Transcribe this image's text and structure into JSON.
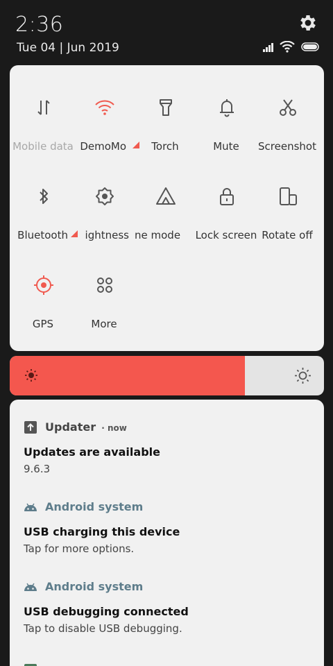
{
  "status_bar": {
    "time": "2:36",
    "date": "Tue 04 | Jun 2019",
    "icons": [
      "signal-icon",
      "wifi-icon",
      "battery-icon"
    ]
  },
  "quick_settings": {
    "tiles": [
      {
        "label": "Mobile data",
        "icon": "data-arrows-icon",
        "state": "off"
      },
      {
        "label": "DemoMo",
        "icon": "wifi-icon",
        "state": "on",
        "expandable": true
      },
      {
        "label": "Torch",
        "icon": "torch-icon",
        "state": "off"
      },
      {
        "label": "Mute",
        "icon": "bell-icon",
        "state": "off"
      },
      {
        "label": "Screenshot",
        "icon": "scissors-icon",
        "state": "off"
      },
      {
        "label": "Bluetooth",
        "icon": "bluetooth-icon",
        "state": "off",
        "expandable": true
      },
      {
        "label": "ightness",
        "icon": "auto-brightness-icon",
        "state": "off"
      },
      {
        "label": "ne mode",
        "icon": "airplane-mode-icon",
        "state": "off"
      },
      {
        "label": "Lock screen",
        "icon": "lock-icon",
        "state": "off"
      },
      {
        "label": "Rotate off",
        "icon": "rotate-icon",
        "state": "off"
      },
      {
        "label": "GPS",
        "icon": "gps-icon",
        "state": "on"
      },
      {
        "label": "More",
        "icon": "grid-icon",
        "state": "off"
      }
    ]
  },
  "brightness": {
    "level_percent": 75,
    "accent": "#f4574e"
  },
  "notifications": [
    {
      "app": "Updater",
      "time": "now",
      "title": "Updates are available",
      "body": "9.6.3",
      "icon": "upload-arrow-icon"
    },
    {
      "app": "Android system",
      "time": "",
      "title": "USB charging this device",
      "body": "Tap for more options.",
      "icon": "android-icon"
    },
    {
      "app": "Android system",
      "time": "",
      "title": "USB debugging connected",
      "body": "Tap to disable USB debugging.",
      "icon": "android-icon"
    }
  ],
  "colors": {
    "accent_on": "#f05a4f",
    "icon_off": "#555555",
    "panel_bg": "#f1f1f1"
  }
}
